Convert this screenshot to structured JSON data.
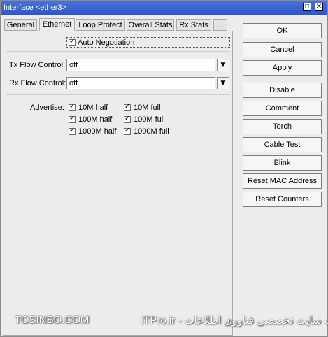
{
  "window": {
    "title": "Interface <ether3>"
  },
  "tabs": [
    {
      "label": "General"
    },
    {
      "label": "Ethernet"
    },
    {
      "label": "Loop Protect"
    },
    {
      "label": "Overall Stats"
    },
    {
      "label": "Rx Stats"
    },
    {
      "label": "..."
    }
  ],
  "auto_negotiation": {
    "label": "Auto Negotiation",
    "checked": true
  },
  "tx_flow": {
    "label": "Tx Flow Control:",
    "value": "off"
  },
  "rx_flow": {
    "label": "Rx Flow Control:",
    "value": "off"
  },
  "advertise": {
    "label": "Advertise:",
    "options": [
      {
        "label": "10M half",
        "checked": true
      },
      {
        "label": "10M full",
        "checked": true
      },
      {
        "label": "100M half",
        "checked": true
      },
      {
        "label": "100M full",
        "checked": true
      },
      {
        "label": "1000M half",
        "checked": true
      },
      {
        "label": "1000M full",
        "checked": true
      }
    ]
  },
  "buttons": [
    "OK",
    "Cancel",
    "Apply",
    "Disable",
    "Comment",
    "Torch",
    "Cable Test",
    "Blink",
    "Reset MAC Address",
    "Reset Counters"
  ],
  "watermark": {
    "left": "TOSINSO.COM",
    "right": "ITPro.ir - وب سایت تخصصی فناوری اطلاعات"
  }
}
